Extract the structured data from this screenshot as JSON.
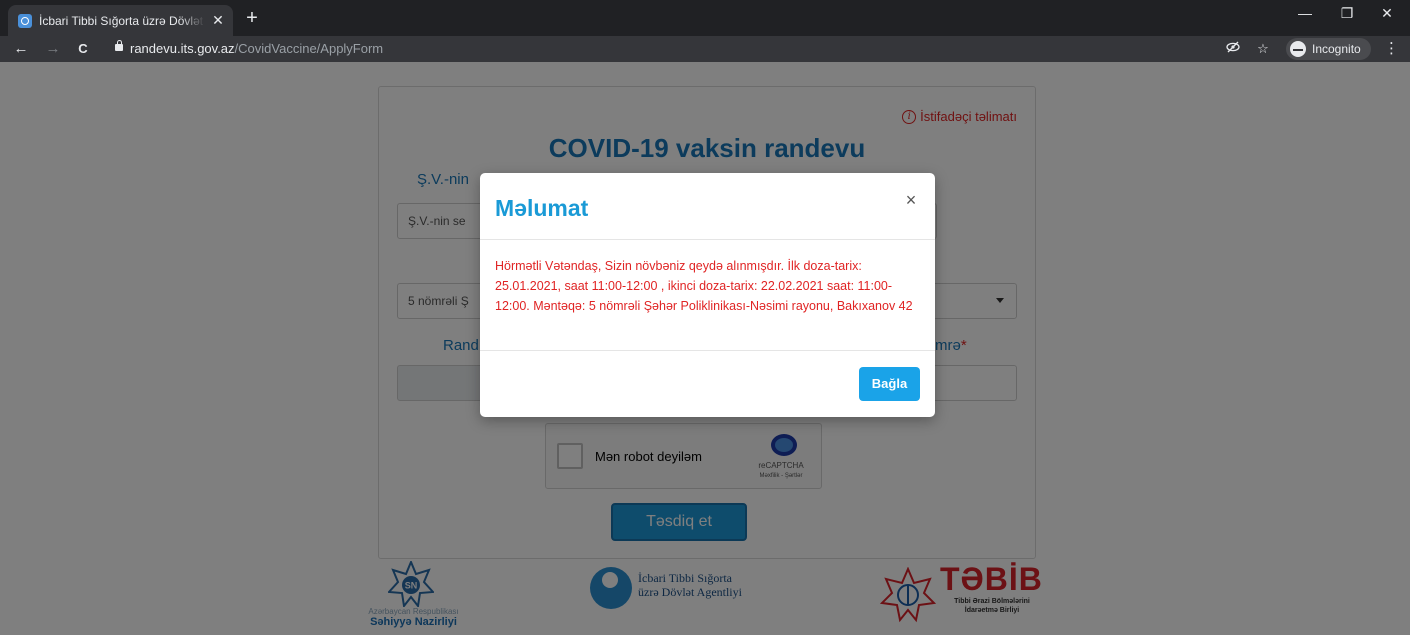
{
  "browser": {
    "tab_title": "İcbari Tibbi Sığorta üzrə Dövlət Agentliyi",
    "tab_close": "✕",
    "new_tab": "+",
    "url_host": "randevu.its.gov.az",
    "url_path": "/CovidVaccine/ApplyForm",
    "incognito_label": "Incognito",
    "controls": {
      "minimize": "—",
      "restore": "❐",
      "close": "✕"
    },
    "nav": {
      "back": "←",
      "forward": "→",
      "reload": "C"
    },
    "icons": [
      "eye-off-icon",
      "star-icon",
      "incognito-icon",
      "kebab-menu-icon"
    ]
  },
  "form": {
    "guide_link": "İstifadəçi təlimatı",
    "guide_icon_glyph": "i",
    "title": "COVID-19 vaksin randevu",
    "name_label": "Ş.V.-nin",
    "name_placeholder": "Ş.V.-nin se",
    "clinic_value": "5 nömrəli Ş",
    "date_label": "Rand",
    "number_label_fragment": "mrə",
    "required_mark": "*",
    "recaptcha_label": "Mən robot deyiləm",
    "recaptcha_brand": "reCAPTCHA",
    "recaptcha_terms": "Məxfilik - Şərtlər",
    "submit_label": "Təsdiq et"
  },
  "logos": {
    "sn_star_text": "SN",
    "sn_subtitle": "Azərbaycan Respublikası",
    "sn_title": "Səhiyyə Nazirliyi",
    "itsda_line1": "İcbari Tibbi Sığorta",
    "itsda_line2": "üzrə Dövlət Agentliyi",
    "tabib_name": "TƏBİB",
    "tabib_subtitle": "Tibbi Ərazi Bölmələrini İdarəetmə Birliyi"
  },
  "modal": {
    "title": "Məlumat",
    "close_glyph": "×",
    "message": "Hörmətli Vətəndaş, Sizin növbəniz qeydə alınmışdır. İlk doza-tarix: 25.01.2021, saat 11:00-12:00 , ikinci doza-tarix: 22.02.2021 saat: 11:00-12:00. Məntəqə: 5 nömrəli Şəhər Poliklinikası-Nəsimi rayonu, Bakıxanov 42",
    "close_button": "Bağla"
  },
  "colors": {
    "accent": "#1a9ad6",
    "title_blue": "#1877b8",
    "error_red": "#e02424",
    "button_blue": "#1aa3e8",
    "tabib_red": "#d8232a"
  }
}
